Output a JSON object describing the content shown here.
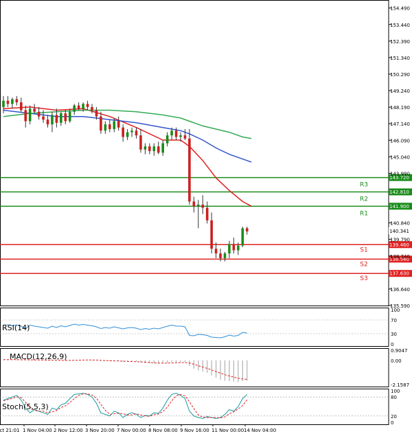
{
  "chart_data": {
    "type": "candlestick",
    "price_axis": {
      "ticks": [
        "154.490",
        "153.440",
        "152.390",
        "151.340",
        "150.290",
        "149.240",
        "148.190",
        "147.140",
        "146.090",
        "145.040",
        "143.990",
        "140.840",
        "139.790",
        "138.740",
        "136.640",
        "135.590"
      ],
      "range": [
        135.59,
        155.0
      ]
    },
    "time_axis": {
      "labels": [
        "Oct 21:01",
        "1 Nov 04:00",
        "2 Nov 12:00",
        "3 Nov 20:00",
        "7 Nov 00:00",
        "8 Nov 08:00",
        "9 Nov 16:00",
        "11 Nov 00:00",
        "14 Nov 04:00"
      ]
    },
    "last_price": "140.341",
    "levels": [
      {
        "name": "R3",
        "value": 143.72,
        "value_label": "143.720",
        "type": "resistance",
        "color": "#1a8c1a"
      },
      {
        "name": "R2",
        "value": 142.81,
        "value_label": "142.810",
        "type": "resistance",
        "color": "#1a8c1a"
      },
      {
        "name": "R1",
        "value": 141.9,
        "value_label": "141.900",
        "type": "resistance",
        "color": "#1a8c1a"
      },
      {
        "name": "S1",
        "value": 139.46,
        "value_label": "139.460",
        "type": "support",
        "color": "#e02020"
      },
      {
        "name": "S2",
        "value": 138.54,
        "value_label": "138.540",
        "type": "support",
        "color": "#e02020"
      },
      {
        "name": "S3",
        "value": 137.63,
        "value_label": "137.630",
        "type": "support",
        "color": "#e02020"
      }
    ],
    "candles": [
      {
        "o": 148.2,
        "h": 148.9,
        "l": 147.8,
        "c": 148.6
      },
      {
        "o": 148.6,
        "h": 148.9,
        "l": 148.2,
        "c": 148.4
      },
      {
        "o": 148.4,
        "h": 148.8,
        "l": 148.1,
        "c": 148.7
      },
      {
        "o": 148.7,
        "h": 148.9,
        "l": 148.3,
        "c": 148.5
      },
      {
        "o": 148.5,
        "h": 148.8,
        "l": 147.9,
        "c": 148.0
      },
      {
        "o": 148.0,
        "h": 148.3,
        "l": 146.9,
        "c": 147.3
      },
      {
        "o": 147.3,
        "h": 148.3,
        "l": 147.1,
        "c": 148.1
      },
      {
        "o": 148.1,
        "h": 148.4,
        "l": 147.8,
        "c": 147.9
      },
      {
        "o": 147.9,
        "h": 148.2,
        "l": 147.4,
        "c": 147.6
      },
      {
        "o": 147.6,
        "h": 148.0,
        "l": 147.2,
        "c": 147.4
      },
      {
        "o": 147.4,
        "h": 147.7,
        "l": 146.9,
        "c": 147.1
      },
      {
        "o": 147.1,
        "h": 147.9,
        "l": 146.6,
        "c": 147.7
      },
      {
        "o": 147.7,
        "h": 148.1,
        "l": 146.9,
        "c": 147.2
      },
      {
        "o": 147.2,
        "h": 147.9,
        "l": 147.0,
        "c": 147.8
      },
      {
        "o": 147.8,
        "h": 148.0,
        "l": 147.1,
        "c": 147.3
      },
      {
        "o": 147.3,
        "h": 148.1,
        "l": 147.2,
        "c": 147.9
      },
      {
        "o": 147.9,
        "h": 148.4,
        "l": 147.7,
        "c": 148.3
      },
      {
        "o": 148.3,
        "h": 148.5,
        "l": 148.0,
        "c": 148.1
      },
      {
        "o": 148.1,
        "h": 148.5,
        "l": 147.9,
        "c": 148.4
      },
      {
        "o": 148.4,
        "h": 148.6,
        "l": 148.0,
        "c": 148.2
      },
      {
        "o": 148.2,
        "h": 148.4,
        "l": 147.8,
        "c": 148.0
      },
      {
        "o": 148.0,
        "h": 148.2,
        "l": 147.4,
        "c": 147.6
      },
      {
        "o": 147.6,
        "h": 147.9,
        "l": 146.5,
        "c": 146.7
      },
      {
        "o": 146.7,
        "h": 147.3,
        "l": 146.5,
        "c": 147.1
      },
      {
        "o": 147.1,
        "h": 147.4,
        "l": 146.6,
        "c": 146.8
      },
      {
        "o": 146.8,
        "h": 147.5,
        "l": 146.6,
        "c": 147.3
      },
      {
        "o": 147.3,
        "h": 147.6,
        "l": 146.7,
        "c": 146.9
      },
      {
        "o": 146.9,
        "h": 147.1,
        "l": 146.0,
        "c": 146.3
      },
      {
        "o": 146.3,
        "h": 146.8,
        "l": 146.1,
        "c": 146.6
      },
      {
        "o": 146.6,
        "h": 146.9,
        "l": 146.3,
        "c": 146.7
      },
      {
        "o": 146.7,
        "h": 146.9,
        "l": 146.2,
        "c": 146.4
      },
      {
        "o": 146.4,
        "h": 146.8,
        "l": 145.3,
        "c": 145.5
      },
      {
        "o": 145.5,
        "h": 145.9,
        "l": 145.2,
        "c": 145.7
      },
      {
        "o": 145.7,
        "h": 145.9,
        "l": 145.2,
        "c": 145.4
      },
      {
        "o": 145.4,
        "h": 145.9,
        "l": 145.1,
        "c": 145.7
      },
      {
        "o": 145.7,
        "h": 146.0,
        "l": 145.2,
        "c": 145.3
      },
      {
        "o": 145.3,
        "h": 146.1,
        "l": 145.1,
        "c": 145.9
      },
      {
        "o": 145.9,
        "h": 146.6,
        "l": 145.7,
        "c": 146.4
      },
      {
        "o": 146.4,
        "h": 146.9,
        "l": 146.1,
        "c": 146.7
      },
      {
        "o": 146.7,
        "h": 146.9,
        "l": 146.1,
        "c": 146.3
      },
      {
        "o": 146.3,
        "h": 146.6,
        "l": 146.0,
        "c": 146.4
      },
      {
        "o": 146.4,
        "h": 146.8,
        "l": 146.1,
        "c": 146.2
      },
      {
        "o": 146.2,
        "h": 146.8,
        "l": 142.0,
        "c": 142.2
      },
      {
        "o": 142.2,
        "h": 142.5,
        "l": 141.5,
        "c": 141.9
      },
      {
        "o": 141.9,
        "h": 142.3,
        "l": 140.5,
        "c": 142.0
      },
      {
        "o": 142.0,
        "h": 142.6,
        "l": 141.4,
        "c": 141.8
      },
      {
        "o": 141.8,
        "h": 142.2,
        "l": 140.8,
        "c": 141.0
      },
      {
        "o": 141.0,
        "h": 141.5,
        "l": 138.9,
        "c": 139.2
      },
      {
        "o": 139.2,
        "h": 139.6,
        "l": 138.6,
        "c": 138.9
      },
      {
        "o": 138.9,
        "h": 139.2,
        "l": 138.4,
        "c": 138.6
      },
      {
        "o": 138.6,
        "h": 139.0,
        "l": 138.4,
        "c": 138.9
      },
      {
        "o": 138.9,
        "h": 139.7,
        "l": 138.6,
        "c": 139.5
      },
      {
        "o": 139.5,
        "h": 139.9,
        "l": 138.9,
        "c": 139.1
      },
      {
        "o": 139.1,
        "h": 139.6,
        "l": 138.8,
        "c": 139.4
      },
      {
        "o": 139.4,
        "h": 140.6,
        "l": 139.3,
        "c": 140.5
      },
      {
        "o": 140.5,
        "h": 140.6,
        "l": 140.1,
        "c": 140.3
      }
    ],
    "moving_averages": [
      {
        "color": "#e02020",
        "points": [
          [
            0,
            148.1
          ],
          [
            6,
            148.2
          ],
          [
            12,
            148.0
          ],
          [
            18,
            148.1
          ],
          [
            24,
            147.6
          ],
          [
            30,
            146.9
          ],
          [
            36,
            146.1
          ],
          [
            40,
            146.1
          ],
          [
            42,
            145.7
          ],
          [
            45,
            144.8
          ],
          [
            48,
            143.7
          ],
          [
            51,
            142.9
          ],
          [
            54,
            142.2
          ],
          [
            56,
            141.9
          ]
        ]
      },
      {
        "color": "#3355cc",
        "points": [
          [
            0,
            148.0
          ],
          [
            6,
            147.8
          ],
          [
            12,
            147.6
          ],
          [
            18,
            147.6
          ],
          [
            24,
            147.4
          ],
          [
            30,
            147.2
          ],
          [
            36,
            146.9
          ],
          [
            40,
            146.7
          ],
          [
            42,
            146.5
          ],
          [
            45,
            146.1
          ],
          [
            48,
            145.6
          ],
          [
            51,
            145.2
          ],
          [
            54,
            144.9
          ],
          [
            56,
            144.7
          ]
        ]
      },
      {
        "color": "#33aa55",
        "points": [
          [
            0,
            147.6
          ],
          [
            6,
            147.8
          ],
          [
            12,
            147.9
          ],
          [
            18,
            148.0
          ],
          [
            24,
            148.0
          ],
          [
            30,
            147.9
          ],
          [
            36,
            147.7
          ],
          [
            40,
            147.5
          ],
          [
            42,
            147.3
          ],
          [
            45,
            147.0
          ],
          [
            48,
            146.8
          ],
          [
            51,
            146.6
          ],
          [
            54,
            146.3
          ],
          [
            56,
            146.2
          ]
        ]
      }
    ],
    "rsi": {
      "label": "RSI(14)",
      "ticks": [
        "100",
        "70",
        "30",
        "0"
      ],
      "range": [
        0,
        100
      ],
      "values": [
        55,
        56,
        53,
        55,
        52,
        45,
        55,
        52,
        50,
        48,
        46,
        52,
        48,
        53,
        50,
        54,
        58,
        55,
        57,
        55,
        53,
        50,
        45,
        48,
        46,
        50,
        47,
        44,
        47,
        48,
        46,
        42,
        45,
        43,
        46,
        44,
        48,
        52,
        55,
        52,
        52,
        50,
        25,
        24,
        28,
        27,
        25,
        20,
        19,
        18,
        21,
        26,
        23,
        25,
        34,
        32
      ]
    },
    "macd": {
      "label": "MACD(12,26,9)",
      "ticks": [
        "0.9047",
        "0.00",
        "-2.1587"
      ],
      "range": [
        -2.1587,
        0.9047
      ],
      "histogram": [
        0.05,
        0.05,
        0.06,
        0.06,
        0.05,
        0.03,
        0.04,
        0.03,
        0.02,
        0.0,
        -0.02,
        0.0,
        -0.02,
        -0.01,
        -0.03,
        -0.01,
        0.02,
        0.03,
        0.05,
        0.05,
        0.04,
        0.02,
        -0.05,
        -0.06,
        -0.08,
        -0.06,
        -0.09,
        -0.12,
        -0.12,
        -0.12,
        -0.14,
        -0.2,
        -0.24,
        -0.27,
        -0.28,
        -0.3,
        -0.28,
        -0.22,
        -0.16,
        -0.16,
        -0.15,
        -0.15,
        -0.5,
        -0.75,
        -0.9,
        -1.0,
        -1.12,
        -1.35,
        -1.55,
        -1.72,
        -1.82,
        -1.85,
        -1.9,
        -1.95,
        -1.85,
        -1.82
      ],
      "signal": [
        0.06,
        0.06,
        0.06,
        0.06,
        0.05,
        0.05,
        0.04,
        0.04,
        0.03,
        0.02,
        0.01,
        0.01,
        0.0,
        0.0,
        -0.01,
        -0.01,
        0.0,
        0.01,
        0.02,
        0.03,
        0.03,
        0.02,
        0.0,
        -0.02,
        -0.04,
        -0.05,
        -0.06,
        -0.08,
        -0.1,
        -0.11,
        -0.12,
        -0.14,
        -0.17,
        -0.2,
        -0.23,
        -0.25,
        -0.26,
        -0.25,
        -0.23,
        -0.22,
        -0.2,
        -0.19,
        -0.25,
        -0.35,
        -0.48,
        -0.6,
        -0.72,
        -0.86,
        -1.0,
        -1.15,
        -1.28,
        -1.4,
        -1.5,
        -1.6,
        -1.66,
        -1.7
      ]
    },
    "stoch": {
      "label": "Stoch(5,5,3)",
      "ticks": [
        "100",
        "80",
        "20",
        "0"
      ],
      "range": [
        0,
        100
      ],
      "k": [
        70,
        75,
        80,
        85,
        70,
        45,
        30,
        40,
        35,
        30,
        25,
        45,
        40,
        55,
        60,
        75,
        88,
        90,
        92,
        88,
        80,
        60,
        30,
        25,
        20,
        35,
        30,
        15,
        25,
        30,
        25,
        15,
        22,
        20,
        30,
        28,
        45,
        70,
        88,
        92,
        85,
        75,
        35,
        20,
        15,
        12,
        18,
        15,
        12,
        15,
        25,
        40,
        35,
        50,
        75,
        88
      ],
      "d": [
        68,
        72,
        76,
        80,
        78,
        63,
        48,
        38,
        35,
        35,
        30,
        33,
        37,
        47,
        52,
        63,
        75,
        85,
        90,
        90,
        86,
        76,
        57,
        38,
        25,
        27,
        28,
        27,
        23,
        23,
        27,
        23,
        20,
        19,
        24,
        26,
        34,
        48,
        68,
        84,
        88,
        84,
        65,
        43,
        23,
        16,
        15,
        15,
        15,
        14,
        17,
        27,
        33,
        42,
        53,
        71
      ]
    }
  }
}
